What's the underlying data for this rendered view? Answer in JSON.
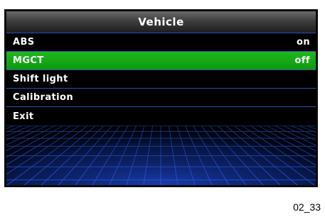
{
  "header": {
    "title": "Vehicle"
  },
  "menu": {
    "items": [
      {
        "label": "ABS",
        "value": "on"
      },
      {
        "label": "MGCT",
        "value": "off"
      },
      {
        "label": "Shift light",
        "value": ""
      },
      {
        "label": "Calibration",
        "value": ""
      },
      {
        "label": "Exit",
        "value": ""
      }
    ],
    "selected_index": 1
  },
  "footer": {
    "code": "02_33"
  },
  "colors": {
    "screen_background": "#000000",
    "selected_row": "#14a814",
    "separator": "#2a4fbf",
    "text": "#ffffff",
    "backdrop_grid": "#1a3fae"
  }
}
